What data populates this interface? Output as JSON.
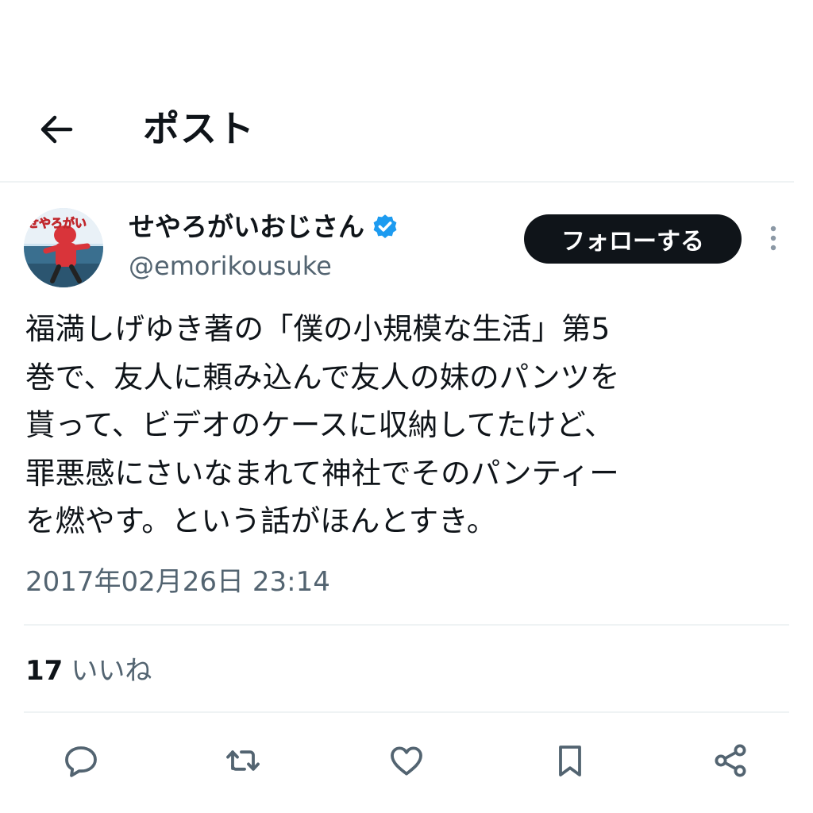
{
  "header": {
    "title": "ポスト",
    "back_icon": "arrow-left-icon"
  },
  "author": {
    "display_name": "せやろがいおじさん",
    "handle": "@emorikousuke",
    "avatar_text": "せやろがい",
    "verified": true,
    "verified_color": "#1d9bf0"
  },
  "follow_button": {
    "label": "フォローする"
  },
  "tweet": {
    "text": "福満しげゆき著の「僕の小規模な生活」第5\n巻で、友人に頼み込んで友人の妹のパンツを\n貰って、ビデオのケースに収納してたけど、\n罪悪感にさいなまれて神社でそのパンティー\nを燃やす。という話がほんとすき。",
    "timestamp": "2017年02月26日 23:14"
  },
  "stats": {
    "likes_count": "17",
    "likes_label": "いいね"
  },
  "actions": [
    "reply-icon",
    "retweet-icon",
    "like-icon",
    "bookmark-icon",
    "share-icon"
  ],
  "colors": {
    "text": "#0f1419",
    "secondary": "#536471",
    "divider": "#eff3f4",
    "accent": "#1d9bf0"
  }
}
